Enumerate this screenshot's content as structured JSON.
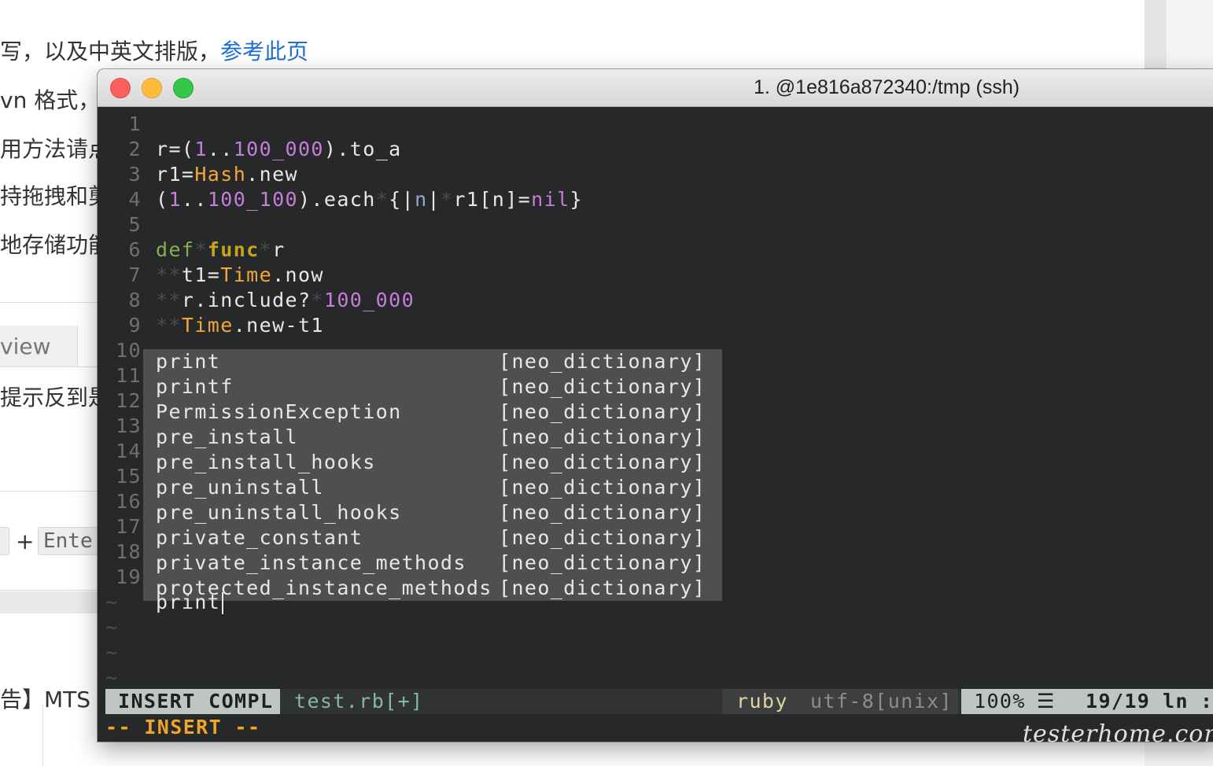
{
  "background": {
    "lines": [
      {
        "text": "写，以及中英文排版，",
        "link": "参考此页"
      },
      {
        "text": "vn 格式，**"
      },
      {
        "text": "用方法请点"
      },
      {
        "text": "持拖拽和剪"
      },
      {
        "text": "地存储功能"
      },
      {
        "text": "提示反到是"
      },
      {
        "text": "告】MTS"
      }
    ],
    "tab_label": "view",
    "key_plus": "+",
    "key_enter": "Ente"
  },
  "window": {
    "title": "1. @1e816a872340:/tmp (ssh)"
  },
  "editor": {
    "line_numbers": [
      "1",
      "2",
      "3",
      "4",
      "5",
      "6",
      "7",
      "8",
      "9",
      "10",
      "11",
      "12",
      "13",
      "14",
      "15",
      "16",
      "17",
      "18",
      "19"
    ],
    "lines": {
      "l1": {
        "a": "r=(",
        "b": "1",
        "c": "..",
        "d": "100_000",
        "e": ").to_a"
      },
      "l2": {
        "a": "r1=",
        "b": "Hash",
        "c": ".new"
      },
      "l3": {
        "a": "(",
        "b": "1",
        "c": "..",
        "d": "100_100",
        "e": ").each",
        "f": "*",
        "g": "{|",
        "h": "n",
        "i": "|",
        "j": "*",
        "k": "r1[n]=",
        "l": "nil",
        "m": "}"
      },
      "l5": {
        "a": "def",
        "b": "*",
        "c": "func",
        "d": "*",
        "e": "r"
      },
      "l6": {
        "a": "**",
        "b": "t1=",
        "c": "Time",
        "d": ".now"
      },
      "l7": {
        "a": "**",
        "b": "r.include?",
        "c": "*",
        "d": "100_000"
      },
      "l8": {
        "a": "**",
        "b": "Time",
        "c": ".new-t1"
      },
      "l19": "print"
    },
    "completions": [
      {
        "word": "print",
        "source": "[neo_dictionary]"
      },
      {
        "word": "printf",
        "source": "[neo_dictionary]"
      },
      {
        "word": "PermissionException",
        "source": "[neo_dictionary]"
      },
      {
        "word": "pre_install",
        "source": "[neo_dictionary]"
      },
      {
        "word": "pre_install_hooks",
        "source": "[neo_dictionary]"
      },
      {
        "word": "pre_uninstall",
        "source": "[neo_dictionary]"
      },
      {
        "word": "pre_uninstall_hooks",
        "source": "[neo_dictionary]"
      },
      {
        "word": "private_constant",
        "source": "[neo_dictionary]"
      },
      {
        "word": "private_instance_methods",
        "source": "[neo_dictionary]"
      },
      {
        "word": "protected_instance_methods",
        "source": "[neo_dictionary]"
      }
    ],
    "tilde": "~"
  },
  "statusline": {
    "mode": "INSERT COMPL",
    "file": "test.rb[+]",
    "filetype": "ruby",
    "encoding": "utf-8[unix]",
    "percent": "100%",
    "menu_glyph": "☰",
    "position": "19/19",
    "ln_label": "ln",
    "col": ":"
  },
  "cmdline": "-- INSERT --",
  "watermark": "testerhome.com",
  "colors": {
    "terminal_bg": "#262829",
    "number": "#c57fd6",
    "constant": "#f2a73a",
    "keyword": "#88b04a",
    "function": "#c7a51b",
    "popup_bg": "#4e5050",
    "insert_msg": "#f0a526"
  }
}
